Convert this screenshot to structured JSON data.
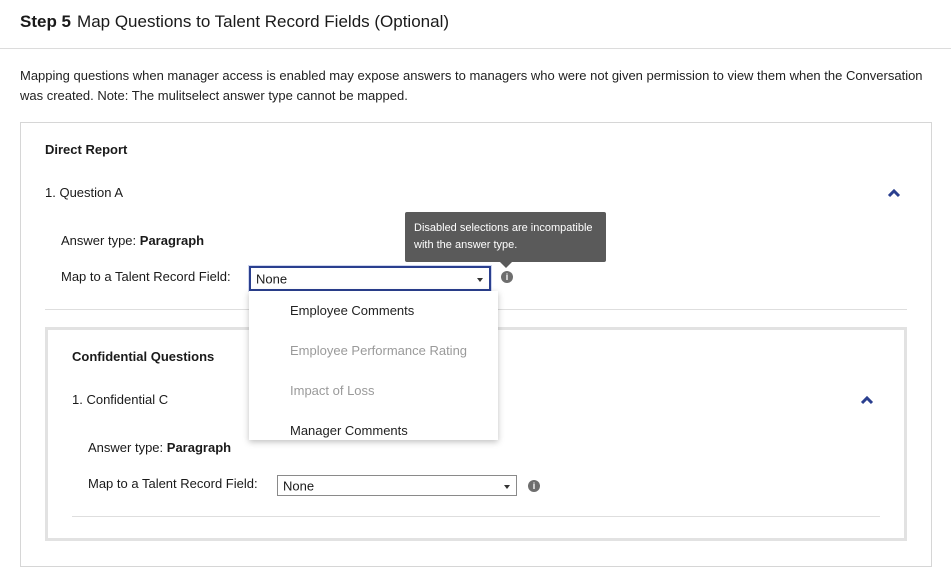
{
  "header": {
    "step_number": "Step 5",
    "title": "Map Questions to Talent Record Fields (Optional)"
  },
  "intro": "Mapping questions when manager access is enabled may expose answers to managers who were not given permission to view them when the Conversation was created. Note: The mulitselect answer type cannot be mapped.",
  "direct_report": {
    "title": "Direct Report",
    "question": "1. Question A",
    "answer_type_label": "Answer type:",
    "answer_type_value": "Paragraph",
    "map_label": "Map to a Talent Record Field:",
    "map_value": "None"
  },
  "confidential": {
    "title": "Confidential Questions",
    "question": "1. Confidential C",
    "answer_type_label": "Answer type:",
    "answer_type_value": "Paragraph",
    "map_label": "Map to a Talent Record Field:",
    "map_value": "None"
  },
  "tooltip": "Disabled selections are incompatible with the answer type.",
  "dropdown": {
    "options": [
      {
        "label": "Employee Comments",
        "disabled": false
      },
      {
        "label": "Employee Performance Rating",
        "disabled": true
      },
      {
        "label": "Impact of Loss",
        "disabled": true
      },
      {
        "label": "Manager Comments",
        "disabled": false
      }
    ]
  },
  "colors": {
    "accent": "#2a3f8f",
    "tooltip_bg": "#5a5a5a",
    "disabled_text": "#9a9a9a"
  },
  "icons": {
    "collapse": "chevron-up-icon",
    "info": "info-icon",
    "caret": "caret-down-icon"
  }
}
